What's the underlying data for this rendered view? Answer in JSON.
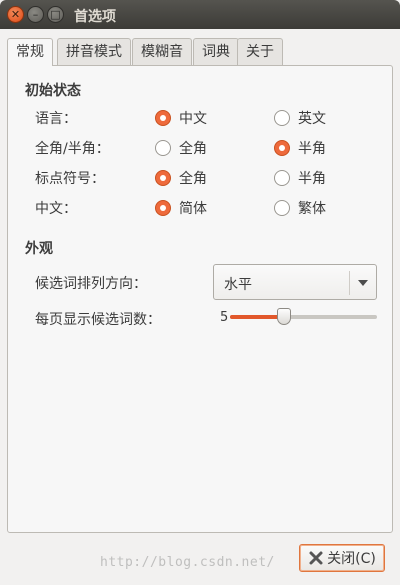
{
  "window": {
    "title": "首选项"
  },
  "window_buttons": {
    "close": "✕",
    "minimize": "–",
    "maximize": "□"
  },
  "tabs": [
    {
      "label": "常规",
      "active": true
    },
    {
      "label": "拼音模式",
      "active": false
    },
    {
      "label": "模糊音",
      "active": false
    },
    {
      "label": "词典",
      "active": false
    },
    {
      "label": "关于",
      "active": false
    }
  ],
  "initial_state": {
    "heading": "初始状态",
    "rows": [
      {
        "label": "语言：",
        "options": [
          {
            "label": "中文",
            "checked": true
          },
          {
            "label": "英文",
            "checked": false
          }
        ]
      },
      {
        "label": "全角/半角：",
        "options": [
          {
            "label": "全角",
            "checked": false
          },
          {
            "label": "半角",
            "checked": true
          }
        ]
      },
      {
        "label": "标点符号：",
        "options": [
          {
            "label": "全角",
            "checked": true
          },
          {
            "label": "半角",
            "checked": false
          }
        ]
      },
      {
        "label": "中文：",
        "options": [
          {
            "label": "简体",
            "checked": true
          },
          {
            "label": "繁体",
            "checked": false
          }
        ]
      }
    ]
  },
  "appearance": {
    "heading": "外观",
    "orientation_label": "候选词排列方向：",
    "orientation_value": "水平",
    "page_size_label": "每页显示候选词数：",
    "page_size_value": "5",
    "page_size_level": 0.37
  },
  "footer": {
    "close_label": "关闭(C)"
  },
  "watermark": "http://blog.csdn.net/",
  "colors": {
    "accent": "#e2582b",
    "titlebar": "#3c3b37",
    "background": "#f2f1f0"
  }
}
